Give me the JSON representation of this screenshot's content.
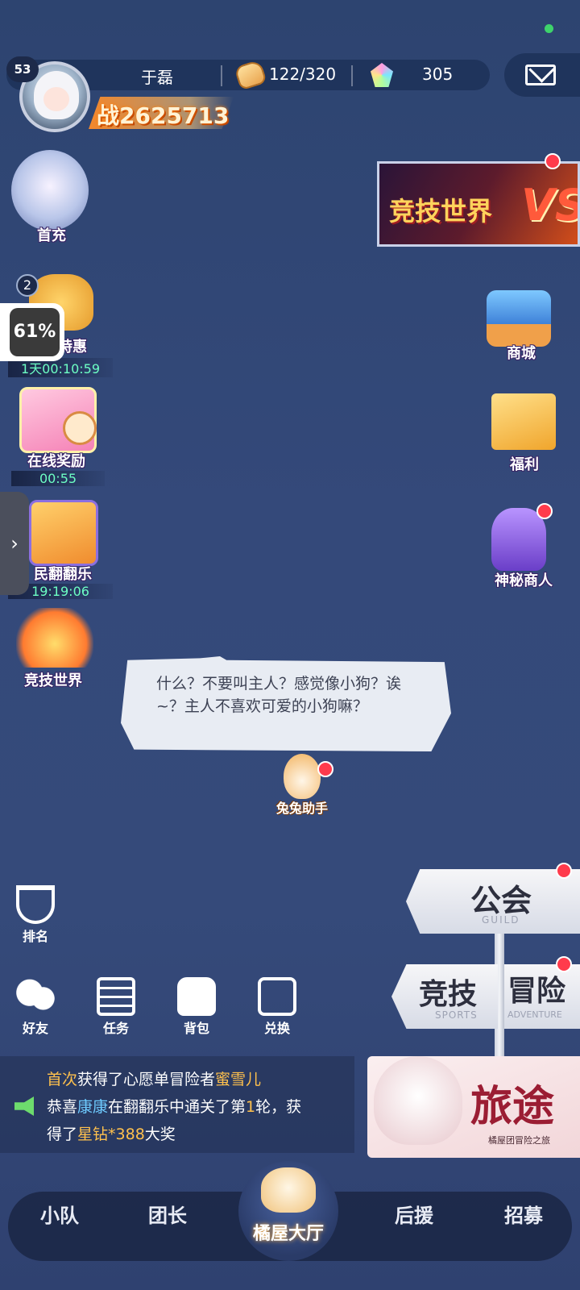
{
  "header": {
    "level": "53",
    "player_name": "于磊",
    "stamina": "122/320",
    "gems": "305",
    "power": "战2625713"
  },
  "left_activities": [
    {
      "label": "首充"
    },
    {
      "label": "特惠",
      "badge": "2",
      "timer": "1天00:10:59"
    },
    {
      "label": "在线奖励",
      "timer": "00:55"
    },
    {
      "label": "民翻翻乐",
      "timer": "19:19:06"
    },
    {
      "label": "竞技世界"
    }
  ],
  "overlay": {
    "percent": "61%",
    "tab_arrow": "›"
  },
  "right_activities": {
    "banner_title": "竞技世界",
    "banner_mark": "VS",
    "items": [
      {
        "label": "商城"
      },
      {
        "label": "福利"
      },
      {
        "label": "神秘商人"
      }
    ]
  },
  "dialogue": {
    "text": "什么？不要叫主人？感觉像小狗？诶~？主人不喜欢可爱的小狗嘛？",
    "assistant_label": "兔兔助手"
  },
  "shortcuts": {
    "rank": "排名",
    "friends": "好友",
    "tasks": "任务",
    "bag": "背包",
    "exchange": "兑换"
  },
  "feed": {
    "line1_a": "首次",
    "line1_b": "获得了心愿单冒险者",
    "line1_c": "蜜雪儿",
    "line2_a": "恭喜",
    "line2_b": "康康",
    "line2_c": "在翻翻乐中通关了第",
    "line2_d": "1",
    "line2_e": "轮，获",
    "line3_a": "得了",
    "line3_b": "星钻*388",
    "line3_c": "大奖"
  },
  "signposts": {
    "guild": "公会",
    "guild_sub": "GUILD",
    "sports": "竞技",
    "sports_sub": "SPORTS",
    "adventure": "冒险",
    "adventure_sub": "ADVENTURE",
    "journey": "旅途",
    "journey_sub": "橘屋团冒险之旅"
  },
  "nav": {
    "team": "小队",
    "leader": "团长",
    "home": "橘屋大厅",
    "support": "后援",
    "recruit": "招募"
  },
  "colors": {
    "background": "#34497a",
    "timer_green": "#6dffc4",
    "highlight_gold": "#ffc14d",
    "highlight_blue": "#6ecbff",
    "notification_red": "#ff3b4c"
  }
}
